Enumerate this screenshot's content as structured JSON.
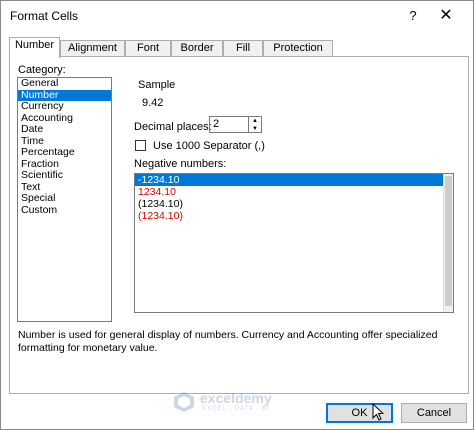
{
  "window": {
    "title": "Format Cells",
    "help_glyph": "?",
    "close_glyph": "✕"
  },
  "tabs": [
    {
      "label": "Number",
      "active": true
    },
    {
      "label": "Alignment",
      "active": false
    },
    {
      "label": "Font",
      "active": false
    },
    {
      "label": "Border",
      "active": false
    },
    {
      "label": "Fill",
      "active": false
    },
    {
      "label": "Protection",
      "active": false
    }
  ],
  "category": {
    "label": "Category:",
    "items": [
      "General",
      "Number",
      "Currency",
      "Accounting",
      "Date",
      "Time",
      "Percentage",
      "Fraction",
      "Scientific",
      "Text",
      "Special",
      "Custom"
    ],
    "selected": "Number"
  },
  "sample": {
    "label": "Sample",
    "value": "9.42"
  },
  "decimal_places": {
    "label": "Decimal places:",
    "value": "2"
  },
  "separator": {
    "label": "Use 1000 Separator (,)",
    "checked": false
  },
  "negative_numbers": {
    "label": "Negative numbers:",
    "items": [
      {
        "text": "-1234.10",
        "color": "#000000",
        "selected": true
      },
      {
        "text": "1234.10",
        "color": "#e00000",
        "selected": false
      },
      {
        "text": "(1234.10)",
        "color": "#000000",
        "selected": false
      },
      {
        "text": "(1234.10)",
        "color": "#e00000",
        "selected": false
      }
    ]
  },
  "description": "Number is used for general display of numbers.  Currency and Accounting offer specialized formatting for monetary value.",
  "buttons": {
    "ok": "OK",
    "cancel": "Cancel"
  },
  "watermark": {
    "name": "exceldemy",
    "tagline": "EXCEL · DATA · BI"
  },
  "colors": {
    "accent": "#0078d7",
    "negative_red": "#e00000"
  }
}
